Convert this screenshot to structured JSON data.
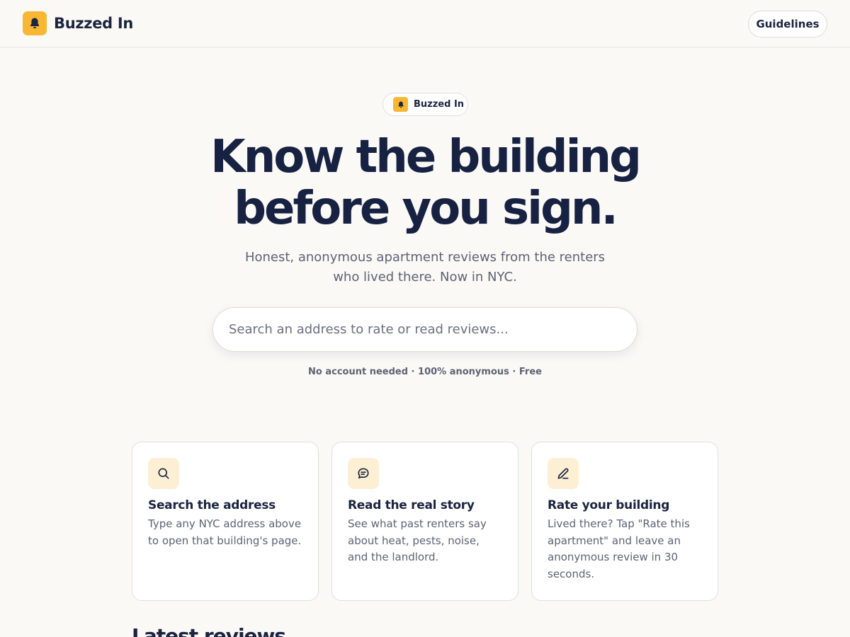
{
  "header": {
    "brand_name": "Buzzed In",
    "guidelines_label": "Guidelines"
  },
  "hero": {
    "badge_label": "Buzzed In",
    "title_line1": "Know the building",
    "title_line2": "before you sign.",
    "subtitle": "Honest, anonymous apartment reviews from the renters who lived there. Now in NYC.",
    "search_placeholder": "Search an address to rate or read reviews...",
    "note": "No account needed · 100% anonymous · Free"
  },
  "features": [
    {
      "icon": "search-icon",
      "title": "Search the address",
      "text": "Type any NYC address above to open that building's page."
    },
    {
      "icon": "chat-icon",
      "title": "Read the real story",
      "text": "See what past renters say about heat, pests, noise, and the landlord."
    },
    {
      "icon": "pencil-icon",
      "title": "Rate your building",
      "text": "Lived there? Tap \"Rate this apartment\" and leave an anonymous review in 30 seconds."
    }
  ],
  "latest": {
    "title": "Latest reviews"
  },
  "colors": {
    "accent": "#f7b733",
    "navy": "#172242",
    "background": "#fbf9f6",
    "icon_tile": "#fdefd3"
  }
}
